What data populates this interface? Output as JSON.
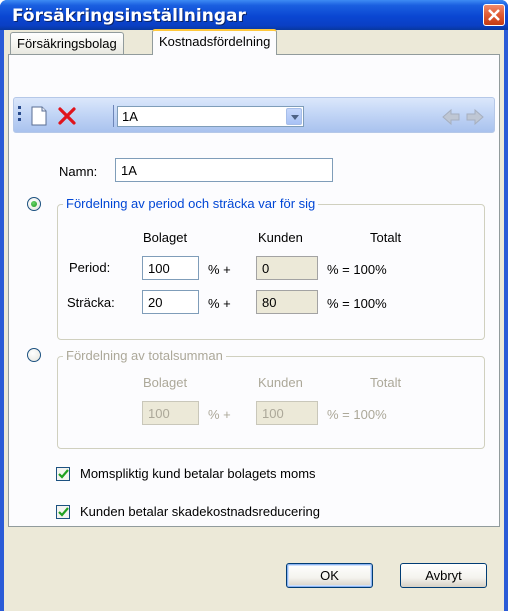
{
  "window": {
    "title": "Försäkringsinställningar"
  },
  "tabs": [
    {
      "label": "Försäkringsbolag"
    },
    {
      "label": "Kostnadsfördelning"
    }
  ],
  "toolbar": {
    "selected_value": "1A"
  },
  "form": {
    "name_label": "Namn:",
    "name_value": "1A",
    "group1": {
      "title": "Fördelning av period och sträcka var för sig",
      "col_company": "Bolaget",
      "col_customer": "Kunden",
      "col_total": "Totalt",
      "rows": [
        {
          "label": "Period:",
          "company": "100",
          "pct_plus": "% +",
          "customer": "0",
          "pct_total": "% = 100%"
        },
        {
          "label": "Sträcka:",
          "company": "20",
          "pct_plus": "% +",
          "customer": "80",
          "pct_total": "% = 100%"
        }
      ]
    },
    "group2": {
      "title": "Fördelning av totalsumman",
      "col_company": "Bolaget",
      "col_customer": "Kunden",
      "col_total": "Totalt",
      "company": "100",
      "pct_plus": "% +",
      "customer": "100",
      "pct_total": "% = 100%"
    },
    "check1": "Momspliktig kund betalar bolagets moms",
    "check2": "Kunden betalar skadekostnadsreducering"
  },
  "buttons": {
    "ok": "OK",
    "cancel": "Avbryt"
  }
}
